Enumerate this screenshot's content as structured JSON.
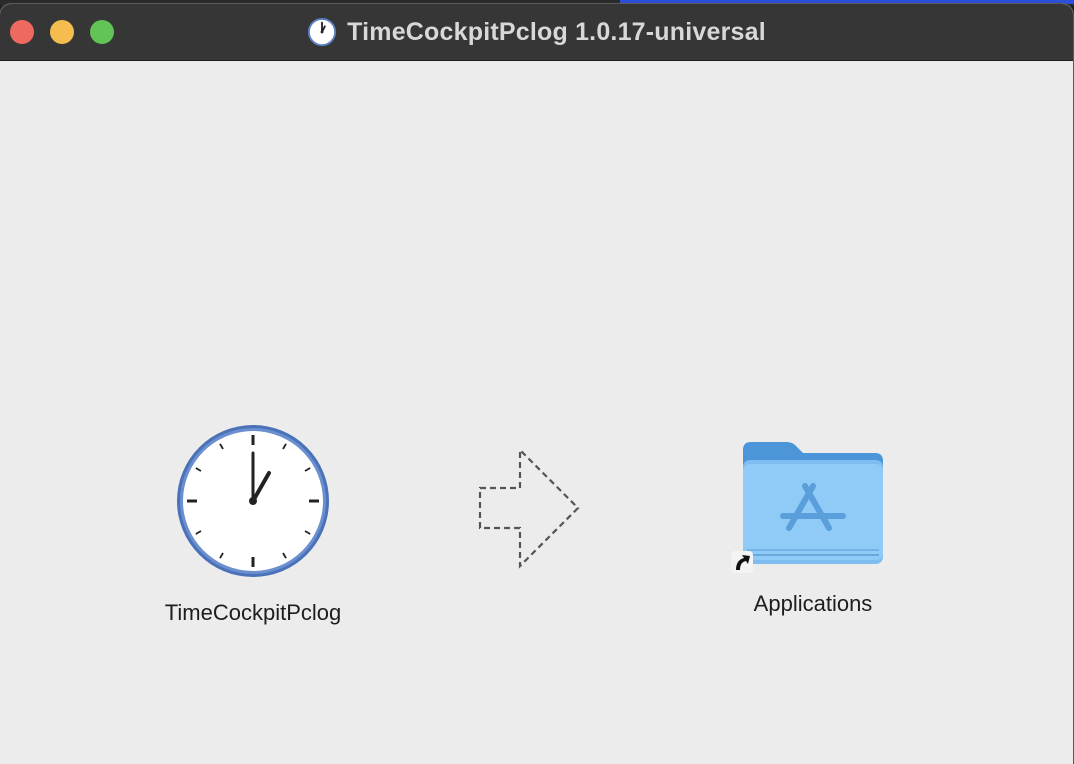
{
  "window": {
    "title": "TimeCockpitPclog 1.0.17-universal",
    "title_icon": "clock-icon"
  },
  "traffic_lights": {
    "close_color": "#ee6a5e",
    "minimize_color": "#f5bd4f",
    "zoom_color": "#61c454"
  },
  "installer": {
    "app": {
      "label": "TimeCockpitPclog",
      "icon": "clock-icon"
    },
    "arrow_icon": "dashed-arrow-icon",
    "destination": {
      "label": "Applications",
      "icon": "applications-folder-icon",
      "alias_icon": "alias-arrow-icon"
    }
  },
  "colors": {
    "background": "#ececec",
    "titlebar": "#363636",
    "folder_blue": "#8cc8f5",
    "clock_ring": "#4a72b8"
  }
}
